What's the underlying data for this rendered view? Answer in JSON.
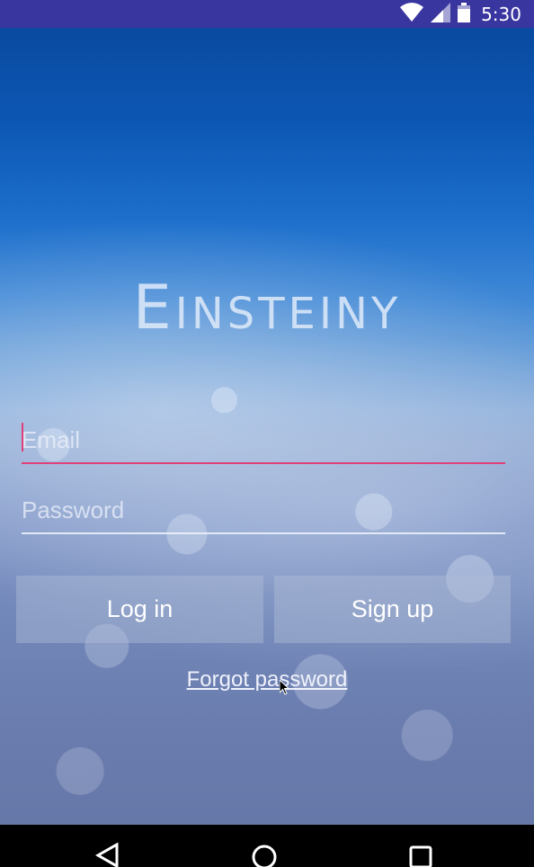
{
  "status_bar": {
    "time": "5:30",
    "icons": [
      "wifi-icon",
      "signal-icon",
      "battery-icon"
    ],
    "color": "#3a36a0"
  },
  "app": {
    "logo_text": "Einsteiny"
  },
  "form": {
    "email": {
      "placeholder": "Email",
      "value": ""
    },
    "password": {
      "placeholder": "Password",
      "value": ""
    },
    "login_label": "Log in",
    "signup_label": "Sign up",
    "forgot_label": "Forgot password",
    "accent_color": "#e0407a"
  },
  "nav_bar": {
    "icons": [
      "back-icon",
      "home-icon",
      "recents-icon"
    ]
  }
}
